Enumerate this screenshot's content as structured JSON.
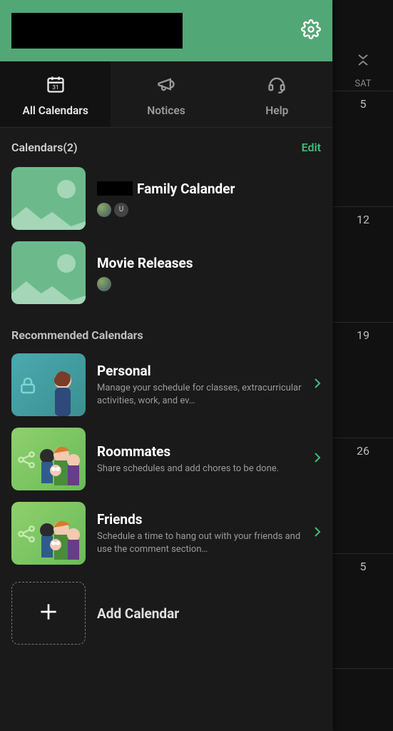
{
  "header": {},
  "tabs": {
    "all_calendars": "All Calendars",
    "notices": "Notices",
    "help": "Help"
  },
  "calendars_section": {
    "title": "Calendars(2)",
    "edit": "Edit"
  },
  "calendars": [
    {
      "name_suffix": "Family Calander",
      "avatar_badge": "U"
    },
    {
      "name": "Movie Releases"
    }
  ],
  "recommended_title": "Recommended Calendars",
  "recommended": [
    {
      "name": "Personal",
      "desc": "Manage your schedule for classes, extracurricular activities, work, and ev…"
    },
    {
      "name": "Roommates",
      "desc": "Share schedules and add chores to be done."
    },
    {
      "name": "Friends",
      "desc": "Schedule a time to hang out with your friends and use the comment section…"
    }
  ],
  "add_calendar": "Add Calendar",
  "bg_day": {
    "label": "SAT",
    "dates": [
      "5",
      "12",
      "19",
      "26",
      "5"
    ]
  }
}
